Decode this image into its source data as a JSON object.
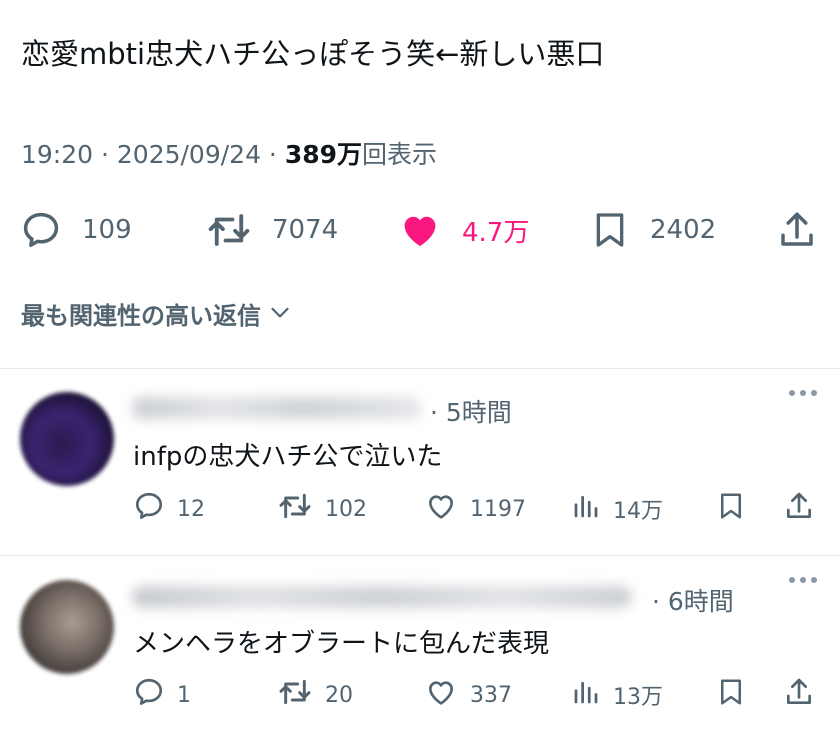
{
  "tweet": {
    "text": "恋愛mbti忠犬ハチ公っぽそう笑←新しい悪口",
    "time": "19:20 · 2025/09/24 · ",
    "views_number": "389万",
    "views_label": "回表示"
  },
  "actions": {
    "replies": "109",
    "retweets": "7074",
    "likes": "4.7万",
    "bookmarks": "2402",
    "like_color": "#f91880",
    "icons": [
      "reply-icon",
      "retweet-icon",
      "heart-filled-icon",
      "bookmark-icon",
      "share-icon"
    ]
  },
  "sort": {
    "label": "最も関連性の高い返信"
  },
  "replies": [
    {
      "time": "· 5時間",
      "text": "infpの忠犬ハチ公で泣いた",
      "reply_count": "12",
      "retweet_count": "102",
      "like_count": "1197",
      "view_count": "14万"
    },
    {
      "time": "· 6時間",
      "text": "メンヘラをオブラートに包んだ表現",
      "reply_count": "1",
      "retweet_count": "20",
      "like_count": "337",
      "view_count": "13万"
    }
  ]
}
